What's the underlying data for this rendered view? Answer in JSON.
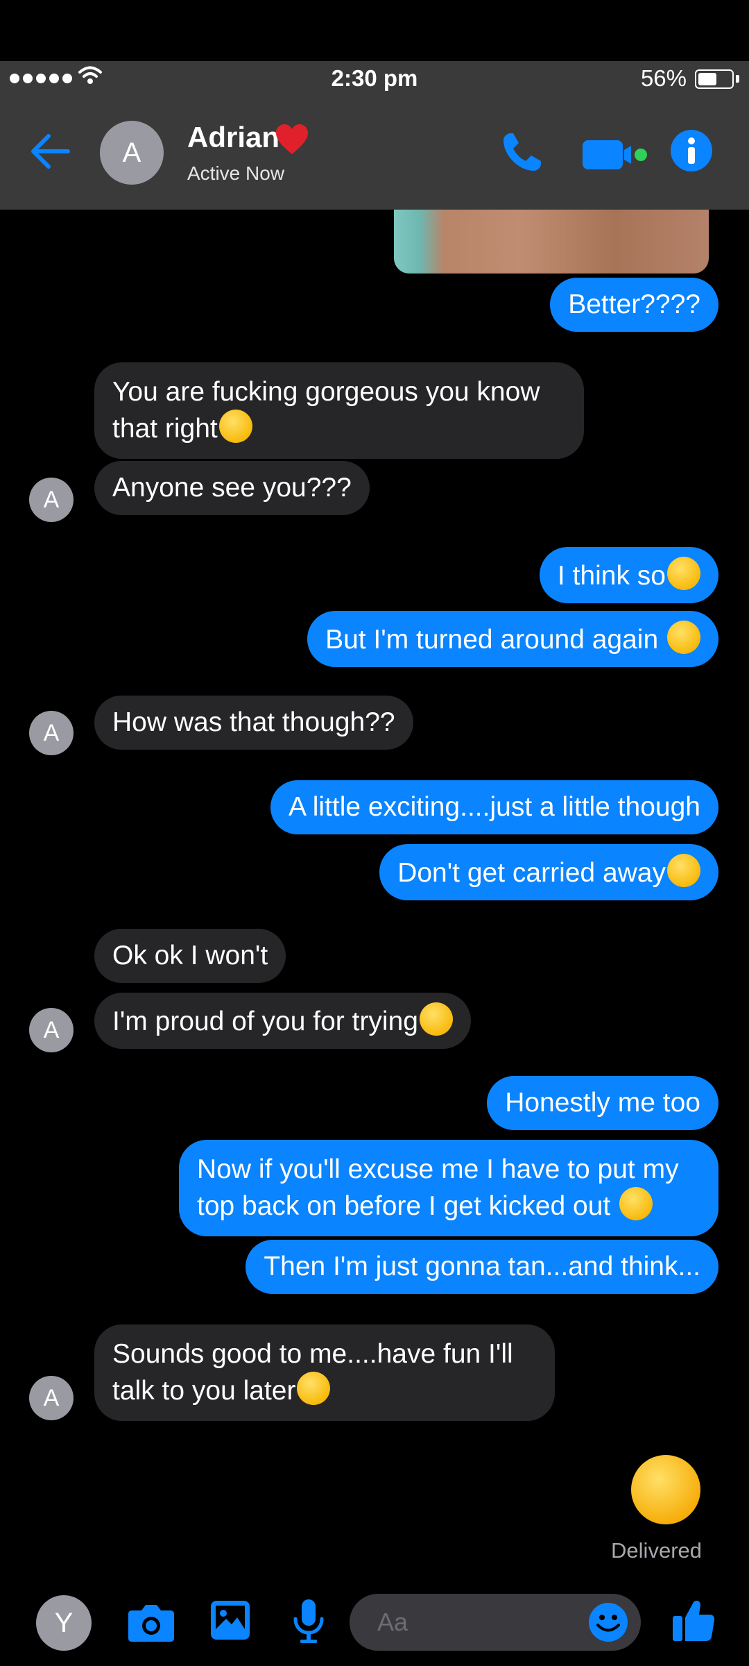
{
  "status_bar": {
    "time": "2:30 pm",
    "battery": "56%",
    "battery_level": 0.56
  },
  "header": {
    "contact_name": "Adrian",
    "contact_initial": "A",
    "active_status": "Active Now"
  },
  "messages": [
    {
      "side": "out",
      "text": "Better????"
    },
    {
      "side": "in",
      "text": "You are fucking gorgeous you know that right",
      "emoji": "drooling-face"
    },
    {
      "side": "in",
      "text": "Anyone see you???"
    },
    {
      "side": "out",
      "text": "I think so",
      "emoji": "hand-over-mouth-face"
    },
    {
      "side": "out",
      "text": "But I'm turned around again ",
      "emoji": "rolling-laughing-face"
    },
    {
      "side": "in",
      "text": "How was that though??"
    },
    {
      "side": "out",
      "text": "A little exciting....just a little though"
    },
    {
      "side": "out",
      "text": "Don't get carried away",
      "emoji": "rolling-laughing-face"
    },
    {
      "side": "in",
      "text": "Ok ok I won't"
    },
    {
      "side": "in",
      "text": "I'm proud of you for trying",
      "emoji": "winking-face"
    },
    {
      "side": "out",
      "text": "Honestly me too"
    },
    {
      "side": "out",
      "text": "Now if you'll excuse me I have to put my top back on before I get kicked out ",
      "emoji": "rolling-laughing-face"
    },
    {
      "side": "out",
      "text": "Then I'm just gonna tan...and think..."
    },
    {
      "side": "in",
      "text": "Sounds good to me....have fun I'll talk to you later",
      "emoji": "kissing-heart-face"
    }
  ],
  "big_emoji": "kissing-heart-face",
  "delivered_label": "Delivered",
  "composer": {
    "user_initial": "Y",
    "placeholder": "Aa"
  },
  "colors": {
    "accent": "#0a84ff",
    "incoming_bubble": "#262629",
    "header_bg": "#3a3a3a",
    "active_green": "#30d158"
  }
}
